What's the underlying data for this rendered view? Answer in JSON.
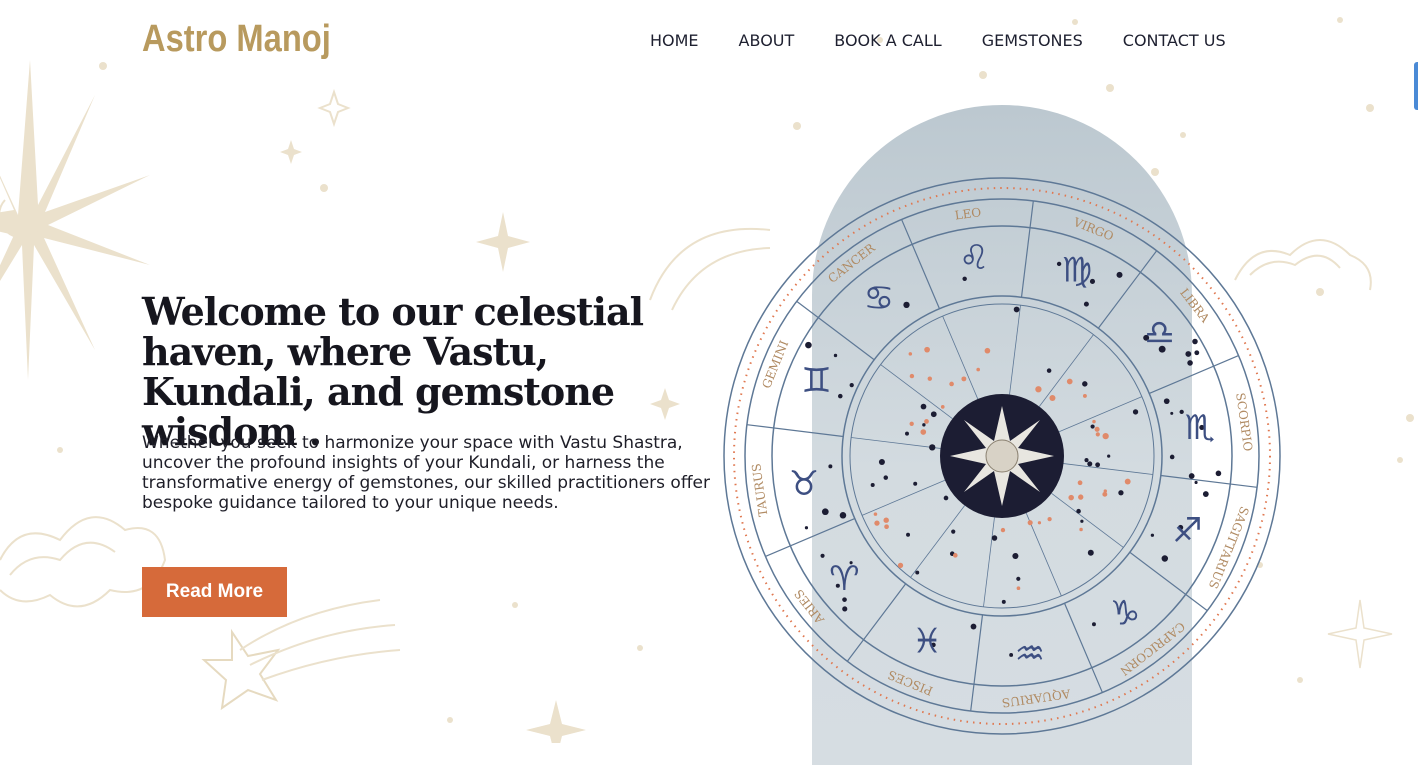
{
  "header": {
    "logo": "Astro Manoj",
    "nav": [
      "HOME",
      "ABOUT",
      "BOOK A CALL",
      "GEMSTONES",
      "CONTACT US"
    ]
  },
  "hero": {
    "headline": "Welcome to our celestial haven, where Vastu, Kundali, and gemstone wisdom .",
    "body": "Whether you seek to harmonize your space with Vastu Shastra, uncover the profound insights of your Kundali, or harness the transformative energy of gemstones, our skilled practitioners offer bespoke guidance tailored to your unique needs.",
    "button_label": "Read More"
  },
  "zodiac_wheel": {
    "signs": [
      {
        "name": "VIRGO",
        "glyph": "♍"
      },
      {
        "name": "LIBRA",
        "glyph": "♎"
      },
      {
        "name": "SCORPIO",
        "glyph": "♏"
      },
      {
        "name": "SAGITTARIUS",
        "glyph": "♐"
      },
      {
        "name": "CAPRICORN",
        "glyph": "♑"
      },
      {
        "name": "AQUARIUS",
        "glyph": "♒"
      },
      {
        "name": "PISCES",
        "glyph": "♓"
      },
      {
        "name": "ARIES",
        "glyph": "♈"
      },
      {
        "name": "TAURUS",
        "glyph": "♉"
      },
      {
        "name": "GEMINI",
        "glyph": "♊"
      },
      {
        "name": "CANCER",
        "glyph": "♋"
      },
      {
        "name": "LEO",
        "glyph": "♌"
      }
    ]
  },
  "colors": {
    "logo": "#b89a5e",
    "button": "#d66a3a",
    "wheel_line": "#5e7896",
    "sign_label": "#b08a62",
    "glyph": "#3d4f82",
    "center": "#1c1d33",
    "decor": "#e8dcc4"
  }
}
